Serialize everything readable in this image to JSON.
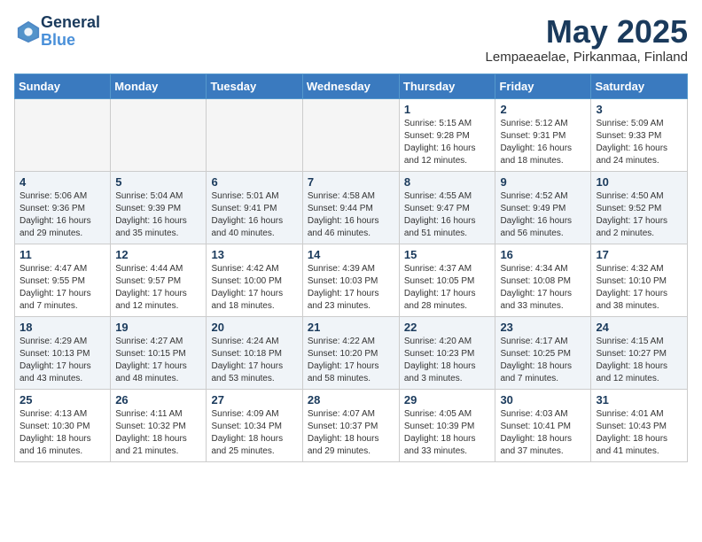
{
  "header": {
    "logo_general": "General",
    "logo_blue": "Blue",
    "month_title": "May 2025",
    "location": "Lempaeaelae, Pirkanmaa, Finland"
  },
  "weekdays": [
    "Sunday",
    "Monday",
    "Tuesday",
    "Wednesday",
    "Thursday",
    "Friday",
    "Saturday"
  ],
  "weeks": [
    [
      {
        "day": "",
        "detail": ""
      },
      {
        "day": "",
        "detail": ""
      },
      {
        "day": "",
        "detail": ""
      },
      {
        "day": "",
        "detail": ""
      },
      {
        "day": "1",
        "detail": "Sunrise: 5:15 AM\nSunset: 9:28 PM\nDaylight: 16 hours\nand 12 minutes."
      },
      {
        "day": "2",
        "detail": "Sunrise: 5:12 AM\nSunset: 9:31 PM\nDaylight: 16 hours\nand 18 minutes."
      },
      {
        "day": "3",
        "detail": "Sunrise: 5:09 AM\nSunset: 9:33 PM\nDaylight: 16 hours\nand 24 minutes."
      }
    ],
    [
      {
        "day": "4",
        "detail": "Sunrise: 5:06 AM\nSunset: 9:36 PM\nDaylight: 16 hours\nand 29 minutes."
      },
      {
        "day": "5",
        "detail": "Sunrise: 5:04 AM\nSunset: 9:39 PM\nDaylight: 16 hours\nand 35 minutes."
      },
      {
        "day": "6",
        "detail": "Sunrise: 5:01 AM\nSunset: 9:41 PM\nDaylight: 16 hours\nand 40 minutes."
      },
      {
        "day": "7",
        "detail": "Sunrise: 4:58 AM\nSunset: 9:44 PM\nDaylight: 16 hours\nand 46 minutes."
      },
      {
        "day": "8",
        "detail": "Sunrise: 4:55 AM\nSunset: 9:47 PM\nDaylight: 16 hours\nand 51 minutes."
      },
      {
        "day": "9",
        "detail": "Sunrise: 4:52 AM\nSunset: 9:49 PM\nDaylight: 16 hours\nand 56 minutes."
      },
      {
        "day": "10",
        "detail": "Sunrise: 4:50 AM\nSunset: 9:52 PM\nDaylight: 17 hours\nand 2 minutes."
      }
    ],
    [
      {
        "day": "11",
        "detail": "Sunrise: 4:47 AM\nSunset: 9:55 PM\nDaylight: 17 hours\nand 7 minutes."
      },
      {
        "day": "12",
        "detail": "Sunrise: 4:44 AM\nSunset: 9:57 PM\nDaylight: 17 hours\nand 12 minutes."
      },
      {
        "day": "13",
        "detail": "Sunrise: 4:42 AM\nSunset: 10:00 PM\nDaylight: 17 hours\nand 18 minutes."
      },
      {
        "day": "14",
        "detail": "Sunrise: 4:39 AM\nSunset: 10:03 PM\nDaylight: 17 hours\nand 23 minutes."
      },
      {
        "day": "15",
        "detail": "Sunrise: 4:37 AM\nSunset: 10:05 PM\nDaylight: 17 hours\nand 28 minutes."
      },
      {
        "day": "16",
        "detail": "Sunrise: 4:34 AM\nSunset: 10:08 PM\nDaylight: 17 hours\nand 33 minutes."
      },
      {
        "day": "17",
        "detail": "Sunrise: 4:32 AM\nSunset: 10:10 PM\nDaylight: 17 hours\nand 38 minutes."
      }
    ],
    [
      {
        "day": "18",
        "detail": "Sunrise: 4:29 AM\nSunset: 10:13 PM\nDaylight: 17 hours\nand 43 minutes."
      },
      {
        "day": "19",
        "detail": "Sunrise: 4:27 AM\nSunset: 10:15 PM\nDaylight: 17 hours\nand 48 minutes."
      },
      {
        "day": "20",
        "detail": "Sunrise: 4:24 AM\nSunset: 10:18 PM\nDaylight: 17 hours\nand 53 minutes."
      },
      {
        "day": "21",
        "detail": "Sunrise: 4:22 AM\nSunset: 10:20 PM\nDaylight: 17 hours\nand 58 minutes."
      },
      {
        "day": "22",
        "detail": "Sunrise: 4:20 AM\nSunset: 10:23 PM\nDaylight: 18 hours\nand 3 minutes."
      },
      {
        "day": "23",
        "detail": "Sunrise: 4:17 AM\nSunset: 10:25 PM\nDaylight: 18 hours\nand 7 minutes."
      },
      {
        "day": "24",
        "detail": "Sunrise: 4:15 AM\nSunset: 10:27 PM\nDaylight: 18 hours\nand 12 minutes."
      }
    ],
    [
      {
        "day": "25",
        "detail": "Sunrise: 4:13 AM\nSunset: 10:30 PM\nDaylight: 18 hours\nand 16 minutes."
      },
      {
        "day": "26",
        "detail": "Sunrise: 4:11 AM\nSunset: 10:32 PM\nDaylight: 18 hours\nand 21 minutes."
      },
      {
        "day": "27",
        "detail": "Sunrise: 4:09 AM\nSunset: 10:34 PM\nDaylight: 18 hours\nand 25 minutes."
      },
      {
        "day": "28",
        "detail": "Sunrise: 4:07 AM\nSunset: 10:37 PM\nDaylight: 18 hours\nand 29 minutes."
      },
      {
        "day": "29",
        "detail": "Sunrise: 4:05 AM\nSunset: 10:39 PM\nDaylight: 18 hours\nand 33 minutes."
      },
      {
        "day": "30",
        "detail": "Sunrise: 4:03 AM\nSunset: 10:41 PM\nDaylight: 18 hours\nand 37 minutes."
      },
      {
        "day": "31",
        "detail": "Sunrise: 4:01 AM\nSunset: 10:43 PM\nDaylight: 18 hours\nand 41 minutes."
      }
    ]
  ]
}
